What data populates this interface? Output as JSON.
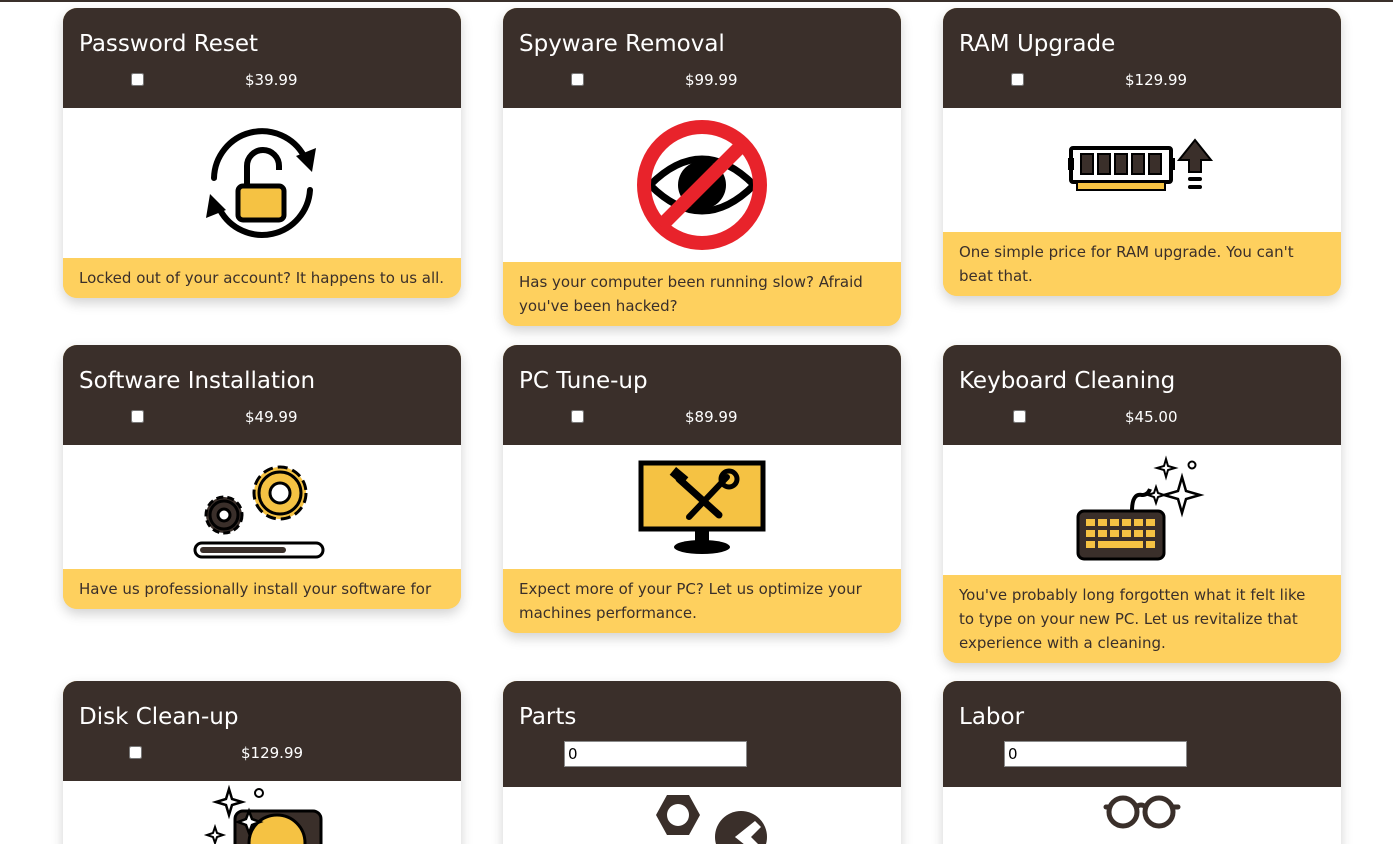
{
  "colors": {
    "header_bg": "#3a2f2a",
    "accent_yellow": "#fed05e",
    "icon_dark": "#000000",
    "icon_yellow": "#f5c243",
    "no_symbol_red": "#e8232b"
  },
  "services": [
    {
      "title": "Password Reset",
      "price": "$39.99",
      "description": "Locked out of your account? It happens to us all.",
      "icon": "unlock-refresh-icon"
    },
    {
      "title": "Spyware Removal",
      "price": "$99.99",
      "description": "Has your computer been running slow? Afraid you've been hacked?",
      "icon": "no-spyware-eye-icon"
    },
    {
      "title": "RAM Upgrade",
      "price": "$129.99",
      "description": "One simple price for RAM upgrade. You can't beat that.",
      "icon": "ram-upgrade-icon"
    },
    {
      "title": "Software Installation",
      "price": "$49.99",
      "description": "Have us professionally install your software for you.",
      "icon": "gears-progress-icon"
    },
    {
      "title": "PC Tune-up",
      "price": "$89.99",
      "description": "Expect more of your PC? Let us optimize your machines performance.",
      "icon": "monitor-tools-icon"
    },
    {
      "title": "Keyboard Cleaning",
      "price": "$45.00",
      "description": "You've probably long forgotten what it felt like to type on your new PC. Let us revitalize that experience with a cleaning.",
      "icon": "sparkling-keyboard-icon"
    },
    {
      "title": "Disk Clean-up",
      "price": "$129.99",
      "icon": "sparkling-disk-icon"
    },
    {
      "title": "Parts",
      "quantity_value": "0",
      "icon": "nut-wrench-icon"
    },
    {
      "title": "Labor",
      "quantity_value": "0",
      "icon": "glasses-icon"
    }
  ]
}
